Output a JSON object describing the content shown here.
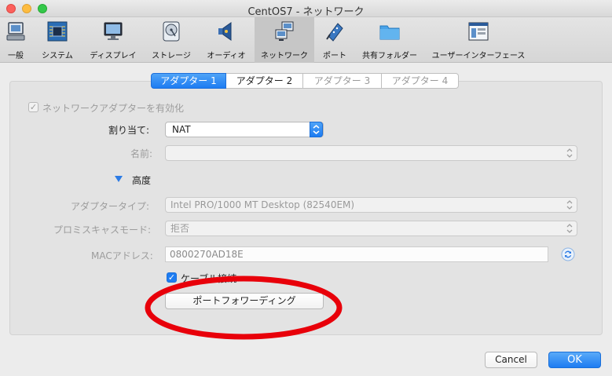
{
  "window": {
    "title": "CentOS7 - ネットワーク"
  },
  "toolbar": {
    "items": [
      {
        "label": "一般",
        "icon": "general-icon"
      },
      {
        "label": "システム",
        "icon": "chip-icon"
      },
      {
        "label": "ディスプレイ",
        "icon": "monitor-icon"
      },
      {
        "label": "ストレージ",
        "icon": "disk-icon"
      },
      {
        "label": "オーディオ",
        "icon": "speaker-icon"
      },
      {
        "label": "ネットワーク",
        "icon": "network-icon",
        "selected": true
      },
      {
        "label": "ポート",
        "icon": "port-icon"
      },
      {
        "label": "共有フォルダー",
        "icon": "folder-icon"
      },
      {
        "label": "ユーザーインターフェース",
        "icon": "ui-icon"
      }
    ]
  },
  "tabs": [
    {
      "label": "アダプター 1",
      "active": true
    },
    {
      "label": "アダプター 2"
    },
    {
      "label": "アダプター 3",
      "disabled": true
    },
    {
      "label": "アダプター 4",
      "disabled": true
    }
  ],
  "form": {
    "enable_label": "ネットワークアダプターを有効化",
    "attach_label": "割り当て:",
    "attach_value": "NAT",
    "name_label": "名前:",
    "name_value": "",
    "advanced_label": "高度",
    "adapter_type_label": "アダプタータイプ:",
    "adapter_type_value": "Intel PRO/1000 MT Desktop (82540EM)",
    "promisc_label": "プロミスキャスモード:",
    "promisc_value": "拒否",
    "mac_label": "MACアドレス:",
    "mac_value": "0800270AD18E",
    "cable_label": "ケーブル接続",
    "port_forward_label": "ポートフォワーディング"
  },
  "buttons": {
    "cancel": "Cancel",
    "ok": "OK"
  },
  "colors": {
    "accent": "#1d7cf2",
    "annotation": "#e8000a"
  }
}
